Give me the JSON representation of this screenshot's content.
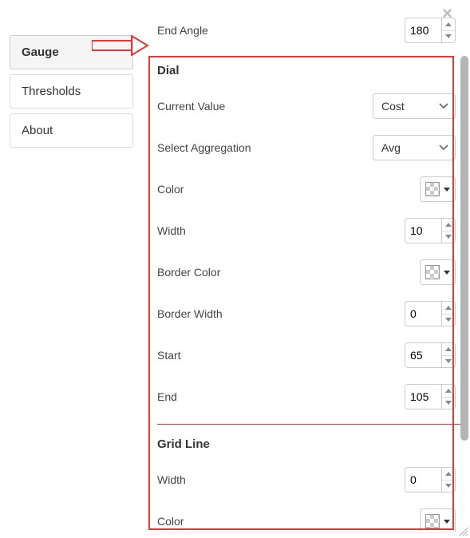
{
  "sidebar": {
    "items": [
      {
        "label": "Gauge",
        "active": true
      },
      {
        "label": "Thresholds",
        "active": false
      },
      {
        "label": "About",
        "active": false
      }
    ]
  },
  "endAngle": {
    "label": "End Angle",
    "value": "180"
  },
  "dial": {
    "header": "Dial",
    "currentValue": {
      "label": "Current Value",
      "value": "Cost"
    },
    "aggregation": {
      "label": "Select Aggregation",
      "value": "Avg"
    },
    "color": {
      "label": "Color"
    },
    "width": {
      "label": "Width",
      "value": "10"
    },
    "borderColor": {
      "label": "Border Color"
    },
    "borderWidth": {
      "label": "Border Width",
      "value": "0"
    },
    "start": {
      "label": "Start",
      "value": "65"
    },
    "end": {
      "label": "End",
      "value": "105"
    }
  },
  "gridLine": {
    "header": "Grid Line",
    "width": {
      "label": "Width",
      "value": "0"
    },
    "color": {
      "label": "Color"
    }
  }
}
